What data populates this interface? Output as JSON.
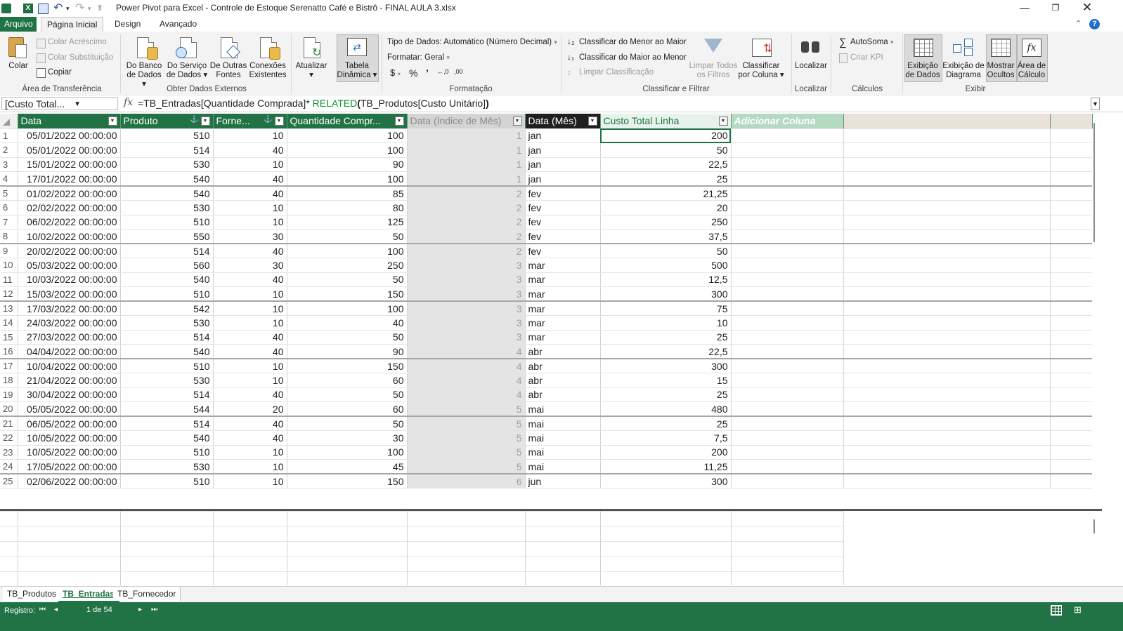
{
  "window": {
    "title": "Power Pivot para Excel - Controle de Estoque Serenatto Café e Bistrô - FINAL AULA 3.xlsx"
  },
  "tabs": [
    "Arquivo",
    "Página Inicial",
    "Design",
    "Avançado"
  ],
  "ribbon": {
    "clipboard": {
      "paste": "Colar",
      "paste_append": "Colar Acréscimo",
      "paste_replace": "Colar Substituição",
      "copy": "Copiar",
      "label": "Área de Transferência"
    },
    "external": {
      "from_db_1": "Do Banco",
      "from_db_2": "de Dados",
      "from_service_1": "Do Serviço",
      "from_service_2": "de Dados",
      "from_other_1": "De Outras",
      "from_other_2": "Fontes",
      "existing_1": "Conexões",
      "existing_2": "Existentes",
      "label": "Obter Dados Externos"
    },
    "refresh": "Atualizar",
    "pivot_1": "Tabela",
    "pivot_2": "Dinâmica",
    "format": {
      "data_type": "Tipo de Dados: Automático (Número Decimal)",
      "format": "Formatar: Geral",
      "currency": "$",
      "percent": "%",
      "comma": "ʼ",
      "inc_decimal": "←,0",
      "dec_decimal": ",00",
      "label": "Formatação"
    },
    "sort": {
      "asc": "Classificar do Menor ao Maior",
      "desc": "Classificar do Maior ao Menor",
      "clear": "Limpar Classificação",
      "clear_filters_1": "Limpar Todos",
      "clear_filters_2": "os Filtros",
      "by_column_1": "Classificar",
      "by_column_2": "por Coluna",
      "label": "Classificar e Filtrar"
    },
    "find": {
      "find": "Localizar",
      "label": "Localizar"
    },
    "calc": {
      "autosum": "AutoSoma",
      "kpi": "Criar KPI",
      "label": "Cálculos"
    },
    "view": {
      "data_view_1": "Exibição",
      "data_view_2": "de Dados",
      "diagram_1": "Exibição de",
      "diagram_2": "Diagrama",
      "hidden_1": "Mostrar",
      "hidden_2": "Ocultos",
      "calc_area_1": "Área de",
      "calc_area_2": "Cálculo",
      "label": "Exibir"
    }
  },
  "formula_bar": {
    "name_box": "[Custo Total...",
    "fx": "fx",
    "part1": "=TB_Entradas[Quantidade Comprada]* ",
    "func": "RELATED",
    "open": "(",
    "part2": "TB_Produtos[Custo Unitário]",
    "close": ")"
  },
  "table": {
    "columns": [
      "Data",
      "Produto",
      "Forne...",
      "Quantidade Compr...",
      "Data (Índice de Mês)",
      "Data (Mês)",
      "Custo Total Linha",
      "Adicionar Coluna"
    ],
    "rows": [
      [
        "1",
        "05/01/2022 00:00:00",
        "510",
        "10",
        "100",
        "1",
        "jan",
        "200"
      ],
      [
        "2",
        "05/01/2022 00:00:00",
        "514",
        "40",
        "100",
        "1",
        "jan",
        "50"
      ],
      [
        "3",
        "15/01/2022 00:00:00",
        "530",
        "10",
        "90",
        "1",
        "jan",
        "22,5"
      ],
      [
        "4",
        "17/01/2022 00:00:00",
        "540",
        "40",
        "100",
        "1",
        "jan",
        "25"
      ],
      [
        "5",
        "01/02/2022 00:00:00",
        "540",
        "40",
        "85",
        "2",
        "fev",
        "21,25"
      ],
      [
        "6",
        "02/02/2022 00:00:00",
        "530",
        "10",
        "80",
        "2",
        "fev",
        "20"
      ],
      [
        "7",
        "06/02/2022 00:00:00",
        "510",
        "10",
        "125",
        "2",
        "fev",
        "250"
      ],
      [
        "8",
        "10/02/2022 00:00:00",
        "550",
        "30",
        "50",
        "2",
        "fev",
        "37,5"
      ],
      [
        "9",
        "20/02/2022 00:00:00",
        "514",
        "40",
        "100",
        "2",
        "fev",
        "50"
      ],
      [
        "10",
        "05/03/2022 00:00:00",
        "560",
        "30",
        "250",
        "3",
        "mar",
        "500"
      ],
      [
        "11",
        "10/03/2022 00:00:00",
        "540",
        "40",
        "50",
        "3",
        "mar",
        "12,5"
      ],
      [
        "12",
        "15/03/2022 00:00:00",
        "510",
        "10",
        "150",
        "3",
        "mar",
        "300"
      ],
      [
        "13",
        "17/03/2022 00:00:00",
        "542",
        "10",
        "100",
        "3",
        "mar",
        "75"
      ],
      [
        "14",
        "24/03/2022 00:00:00",
        "530",
        "10",
        "40",
        "3",
        "mar",
        "10"
      ],
      [
        "15",
        "27/03/2022 00:00:00",
        "514",
        "40",
        "50",
        "3",
        "mar",
        "25"
      ],
      [
        "16",
        "04/04/2022 00:00:00",
        "540",
        "40",
        "90",
        "4",
        "abr",
        "22,5"
      ],
      [
        "17",
        "10/04/2022 00:00:00",
        "510",
        "10",
        "150",
        "4",
        "abr",
        "300"
      ],
      [
        "18",
        "21/04/2022 00:00:00",
        "530",
        "10",
        "60",
        "4",
        "abr",
        "15"
      ],
      [
        "19",
        "30/04/2022 00:00:00",
        "514",
        "40",
        "50",
        "4",
        "abr",
        "25"
      ],
      [
        "20",
        "05/05/2022 00:00:00",
        "544",
        "20",
        "60",
        "5",
        "mai",
        "480"
      ],
      [
        "21",
        "06/05/2022 00:00:00",
        "514",
        "40",
        "50",
        "5",
        "mai",
        "25"
      ],
      [
        "22",
        "10/05/2022 00:00:00",
        "540",
        "40",
        "30",
        "5",
        "mai",
        "7,5"
      ],
      [
        "23",
        "10/05/2022 00:00:00",
        "510",
        "10",
        "100",
        "5",
        "mai",
        "200"
      ],
      [
        "24",
        "17/05/2022 00:00:00",
        "530",
        "10",
        "45",
        "5",
        "mai",
        "11,25"
      ],
      [
        "25",
        "02/06/2022 00:00:00",
        "510",
        "10",
        "150",
        "6",
        "jun",
        "300"
      ]
    ]
  },
  "sheets": [
    "TB_Produtos",
    "TB_Entradas",
    "TB_Fornecedor"
  ],
  "status": {
    "record_label": "Registro:",
    "first": "⏮",
    "prev": "◂",
    "position": "1 de 54",
    "next": "▸",
    "last": "⏭"
  },
  "colors": {
    "accent": "#217346",
    "formula_keyword": "#0a8f2a"
  }
}
